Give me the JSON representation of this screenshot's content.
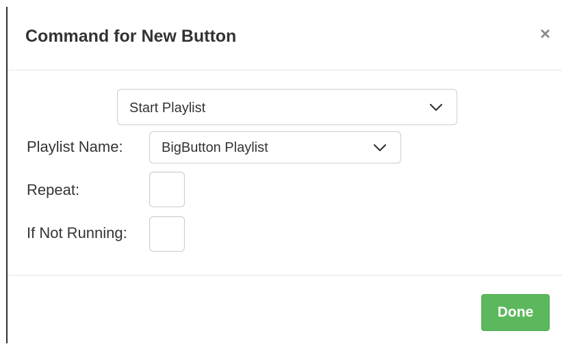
{
  "modal": {
    "title": "Command for New Button",
    "close_label": "×"
  },
  "command": {
    "selected": "Start Playlist",
    "icon": "chevron-down-icon"
  },
  "fields": {
    "playlist_name_label": "Playlist Name:",
    "playlist_name_value": "BigButton Playlist",
    "repeat_label": "Repeat:",
    "repeat_checked": false,
    "if_not_running_label": "If Not Running:",
    "if_not_running_checked": false
  },
  "footer": {
    "done_label": "Done"
  },
  "colors": {
    "done_button": "#5cb85c",
    "border": "#cccccc",
    "text": "#333333"
  }
}
